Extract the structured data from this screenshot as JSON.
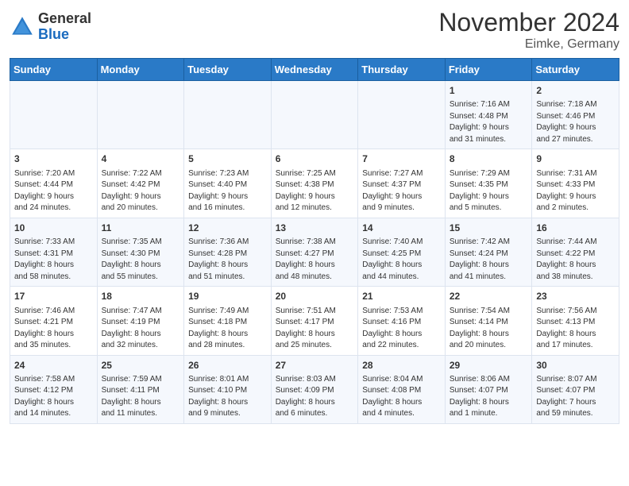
{
  "logo": {
    "general": "General",
    "blue": "Blue"
  },
  "header": {
    "month": "November 2024",
    "location": "Eimke, Germany"
  },
  "weekdays": [
    "Sunday",
    "Monday",
    "Tuesday",
    "Wednesday",
    "Thursday",
    "Friday",
    "Saturday"
  ],
  "weeks": [
    [
      {
        "day": "",
        "info": ""
      },
      {
        "day": "",
        "info": ""
      },
      {
        "day": "",
        "info": ""
      },
      {
        "day": "",
        "info": ""
      },
      {
        "day": "",
        "info": ""
      },
      {
        "day": "1",
        "info": "Sunrise: 7:16 AM\nSunset: 4:48 PM\nDaylight: 9 hours\nand 31 minutes."
      },
      {
        "day": "2",
        "info": "Sunrise: 7:18 AM\nSunset: 4:46 PM\nDaylight: 9 hours\nand 27 minutes."
      }
    ],
    [
      {
        "day": "3",
        "info": "Sunrise: 7:20 AM\nSunset: 4:44 PM\nDaylight: 9 hours\nand 24 minutes."
      },
      {
        "day": "4",
        "info": "Sunrise: 7:22 AM\nSunset: 4:42 PM\nDaylight: 9 hours\nand 20 minutes."
      },
      {
        "day": "5",
        "info": "Sunrise: 7:23 AM\nSunset: 4:40 PM\nDaylight: 9 hours\nand 16 minutes."
      },
      {
        "day": "6",
        "info": "Sunrise: 7:25 AM\nSunset: 4:38 PM\nDaylight: 9 hours\nand 12 minutes."
      },
      {
        "day": "7",
        "info": "Sunrise: 7:27 AM\nSunset: 4:37 PM\nDaylight: 9 hours\nand 9 minutes."
      },
      {
        "day": "8",
        "info": "Sunrise: 7:29 AM\nSunset: 4:35 PM\nDaylight: 9 hours\nand 5 minutes."
      },
      {
        "day": "9",
        "info": "Sunrise: 7:31 AM\nSunset: 4:33 PM\nDaylight: 9 hours\nand 2 minutes."
      }
    ],
    [
      {
        "day": "10",
        "info": "Sunrise: 7:33 AM\nSunset: 4:31 PM\nDaylight: 8 hours\nand 58 minutes."
      },
      {
        "day": "11",
        "info": "Sunrise: 7:35 AM\nSunset: 4:30 PM\nDaylight: 8 hours\nand 55 minutes."
      },
      {
        "day": "12",
        "info": "Sunrise: 7:36 AM\nSunset: 4:28 PM\nDaylight: 8 hours\nand 51 minutes."
      },
      {
        "day": "13",
        "info": "Sunrise: 7:38 AM\nSunset: 4:27 PM\nDaylight: 8 hours\nand 48 minutes."
      },
      {
        "day": "14",
        "info": "Sunrise: 7:40 AM\nSunset: 4:25 PM\nDaylight: 8 hours\nand 44 minutes."
      },
      {
        "day": "15",
        "info": "Sunrise: 7:42 AM\nSunset: 4:24 PM\nDaylight: 8 hours\nand 41 minutes."
      },
      {
        "day": "16",
        "info": "Sunrise: 7:44 AM\nSunset: 4:22 PM\nDaylight: 8 hours\nand 38 minutes."
      }
    ],
    [
      {
        "day": "17",
        "info": "Sunrise: 7:46 AM\nSunset: 4:21 PM\nDaylight: 8 hours\nand 35 minutes."
      },
      {
        "day": "18",
        "info": "Sunrise: 7:47 AM\nSunset: 4:19 PM\nDaylight: 8 hours\nand 32 minutes."
      },
      {
        "day": "19",
        "info": "Sunrise: 7:49 AM\nSunset: 4:18 PM\nDaylight: 8 hours\nand 28 minutes."
      },
      {
        "day": "20",
        "info": "Sunrise: 7:51 AM\nSunset: 4:17 PM\nDaylight: 8 hours\nand 25 minutes."
      },
      {
        "day": "21",
        "info": "Sunrise: 7:53 AM\nSunset: 4:16 PM\nDaylight: 8 hours\nand 22 minutes."
      },
      {
        "day": "22",
        "info": "Sunrise: 7:54 AM\nSunset: 4:14 PM\nDaylight: 8 hours\nand 20 minutes."
      },
      {
        "day": "23",
        "info": "Sunrise: 7:56 AM\nSunset: 4:13 PM\nDaylight: 8 hours\nand 17 minutes."
      }
    ],
    [
      {
        "day": "24",
        "info": "Sunrise: 7:58 AM\nSunset: 4:12 PM\nDaylight: 8 hours\nand 14 minutes."
      },
      {
        "day": "25",
        "info": "Sunrise: 7:59 AM\nSunset: 4:11 PM\nDaylight: 8 hours\nand 11 minutes."
      },
      {
        "day": "26",
        "info": "Sunrise: 8:01 AM\nSunset: 4:10 PM\nDaylight: 8 hours\nand 9 minutes."
      },
      {
        "day": "27",
        "info": "Sunrise: 8:03 AM\nSunset: 4:09 PM\nDaylight: 8 hours\nand 6 minutes."
      },
      {
        "day": "28",
        "info": "Sunrise: 8:04 AM\nSunset: 4:08 PM\nDaylight: 8 hours\nand 4 minutes."
      },
      {
        "day": "29",
        "info": "Sunrise: 8:06 AM\nSunset: 4:07 PM\nDaylight: 8 hours\nand 1 minute."
      },
      {
        "day": "30",
        "info": "Sunrise: 8:07 AM\nSunset: 4:07 PM\nDaylight: 7 hours\nand 59 minutes."
      }
    ]
  ]
}
